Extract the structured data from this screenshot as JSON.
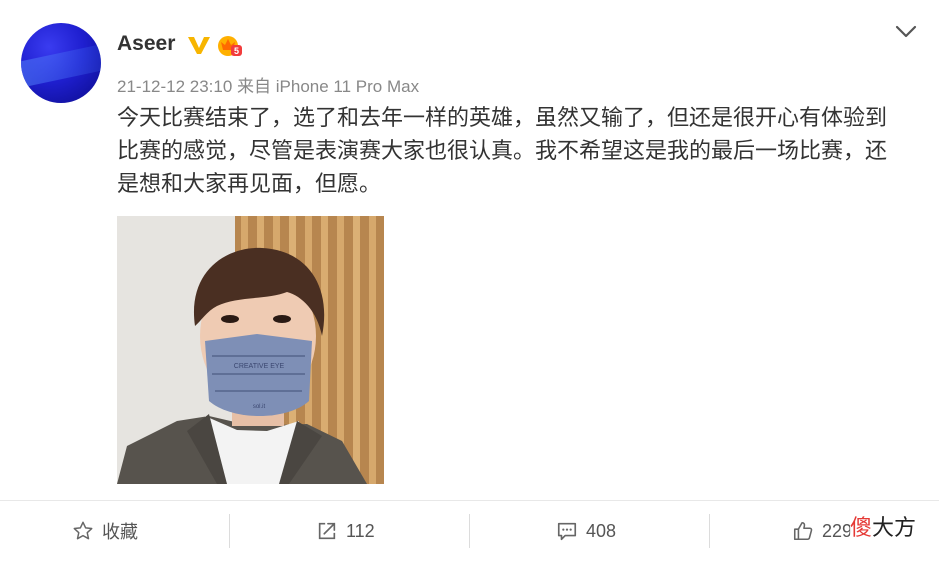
{
  "post": {
    "username": "Aseer",
    "meta": "21-12-12 23:10 来自 iPhone 11 Pro Max",
    "content": "今天比赛结束了，选了和去年一样的英雄，虽然又输了，但还是很开心有体验到\n比赛的感觉，尽管是表演赛大家也很认真。我不希望这是我的最后一场比赛，还\n是想和大家再见面，但愿。",
    "photo": {
      "mask_text_1": "CREATIVE EYE",
      "mask_text_2": "sol.it"
    }
  },
  "badges": {
    "verified_color": "#f7b500",
    "vip_level": "5"
  },
  "actions": {
    "favorite_label": "收藏",
    "share_count": "112",
    "comment_count": "408",
    "like_count": "229"
  },
  "watermark": {
    "first_char": "傻",
    "rest": "大方"
  },
  "colors": {
    "text": "#333333",
    "meta": "#888888",
    "accent_red": "#e53935"
  }
}
